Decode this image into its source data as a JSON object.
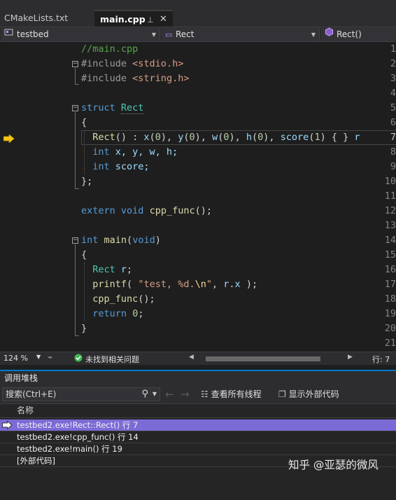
{
  "tabs": [
    {
      "label": "CMakeLists.txt",
      "active": false
    },
    {
      "label": "main.cpp",
      "active": true,
      "pin_icon": "pin-icon",
      "close_icon": "close-icon"
    }
  ],
  "navbar": {
    "project": "testbed",
    "scope": "Rect",
    "member": "Rect()"
  },
  "editor": {
    "line_numbers": [
      "1",
      "2",
      "3",
      "4",
      "5",
      "6",
      "7",
      "8",
      "9",
      "10",
      "11",
      "12",
      "13",
      "14",
      "15",
      "16",
      "17",
      "18",
      "19",
      "20",
      "21"
    ],
    "current_line": "7"
  },
  "code_text": {
    "l1": "//main.cpp",
    "l2_kw": "#include",
    "l2_hdr": "<stdio.h>",
    "l3_kw": "#include",
    "l3_hdr": "<string.h>",
    "l5_kw": "struct",
    "l5_ty": "Rect",
    "brace_open": "{",
    "brace_close": "};",
    "brace_close_fn": "}",
    "l7_fn": "Rect",
    "l7_a": "() : ",
    "l7_x": "x",
    "l7_b": "(",
    "zero": "0",
    "l7_c": "), ",
    "l7_y": "y",
    "l7_w": "w",
    "l7_h": "h",
    "l7_score": "score",
    "one": "1",
    "l7_end": ") { } ",
    "l7_tail": "r",
    "kw_int": "int",
    "l8_vars": " x, y, w, h;",
    "l9_var": " score;",
    "kw_extern": "extern",
    "kw_void": "void",
    "l12_fn": "cpp_func",
    "l12_end": "();",
    "l14_fn": "main",
    "l14_a": "(",
    "l14_b": ")",
    "l16_ty": "Rect",
    "l16_var": " r",
    "semi": ";",
    "l17_fn": "printf",
    "l17_a": "( ",
    "l17_str": "\"test, %d.",
    "l17_esc": "\\n",
    "l17_str2": "\"",
    "l17_b": ", ",
    "l17_r": "r",
    "l17_dot": ".",
    "l17_x": "x",
    "l17_end": " );",
    "l18_fn": "cpp_func",
    "l18_end": "();",
    "kw_return": "return",
    "l19_end": ";"
  },
  "statusbar": {
    "zoom": "124 %",
    "issues": "未找到相关问题",
    "line_label": "行: 7"
  },
  "callstack": {
    "title": "调用堆栈",
    "search_placeholder": "搜索(Ctrl+E)",
    "btn_all_threads": "查看所有线程",
    "btn_external": "显示外部代码",
    "column_name": "名称",
    "rows": [
      {
        "text": "testbed2.exe!Rect::Rect() 行 7",
        "current": true
      },
      {
        "text": "testbed2.exe!cpp_func() 行 14",
        "current": false
      },
      {
        "text": "testbed2.exe!main() 行 19",
        "current": false
      },
      {
        "text": "[外部代码]",
        "current": false
      }
    ]
  },
  "watermark": "知乎 @亚瑟的微风",
  "colors": {
    "accent": "#007acc",
    "selected_row": "#7b6bd6",
    "exec_arrow": "#f5c518",
    "issues_ok": "#3fb950"
  }
}
